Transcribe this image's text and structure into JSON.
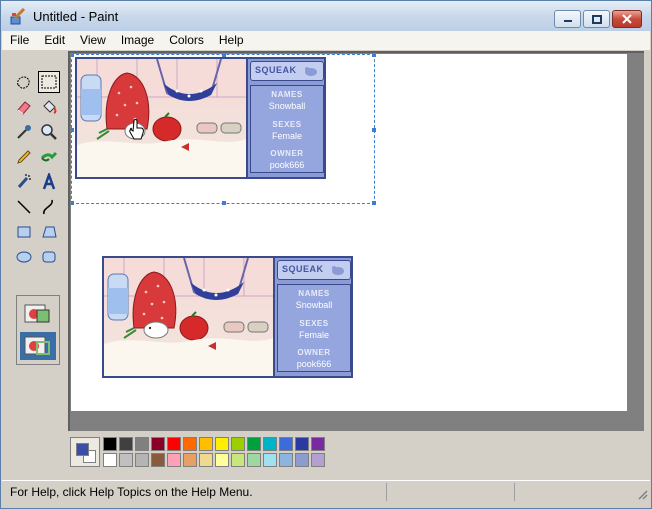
{
  "window": {
    "title": "Untitled - Paint",
    "icons": {
      "app": "paint-app-icon",
      "minimize": "minimize-icon",
      "maximize": "maximize-icon",
      "close": "close-icon"
    }
  },
  "menu": [
    "File",
    "Edit",
    "View",
    "Image",
    "Colors",
    "Help"
  ],
  "tools": [
    "free-form-select",
    "select",
    "eraser",
    "fill-with-color",
    "pick-color",
    "magnifier",
    "pencil",
    "brush",
    "airbrush",
    "text",
    "line",
    "curve",
    "rectangle",
    "polygon",
    "ellipse",
    "rounded-rectangle"
  ],
  "selected_tool": "select",
  "tool_options": [
    "opaque-selection",
    "transparent-selection"
  ],
  "selected_tool_option": "transparent-selection",
  "pet_card": {
    "header": "SQUEAK",
    "fields": [
      {
        "label": "NAMES",
        "value": "Snowball"
      },
      {
        "label": "SEXES",
        "value": "Female"
      },
      {
        "label": "OWNER",
        "value": "pook666"
      }
    ]
  },
  "colors": {
    "foreground": "#3a4ea6",
    "background": "#ffffff",
    "palette_top": [
      "#000000",
      "#404040",
      "#808080",
      "#8b0029",
      "#ff0000",
      "#ff6a00",
      "#ffbf00",
      "#ffee00",
      "#9ccf00",
      "#00a03c",
      "#00b4c8",
      "#3c6cdc",
      "#2a3aa0",
      "#7a2aa0"
    ],
    "palette_bottom": [
      "#ffffff",
      "#c0c0c0",
      "#b4b4b4",
      "#8a5a3c",
      "#ffa0b4",
      "#e6a064",
      "#f0d890",
      "#ffff9c",
      "#c8e67c",
      "#9cd8a0",
      "#a0e0f0",
      "#8cb4e0",
      "#8c9cd0",
      "#b4a0d0"
    ]
  },
  "status": {
    "text": "For Help, click Help Topics on the Help Menu."
  }
}
